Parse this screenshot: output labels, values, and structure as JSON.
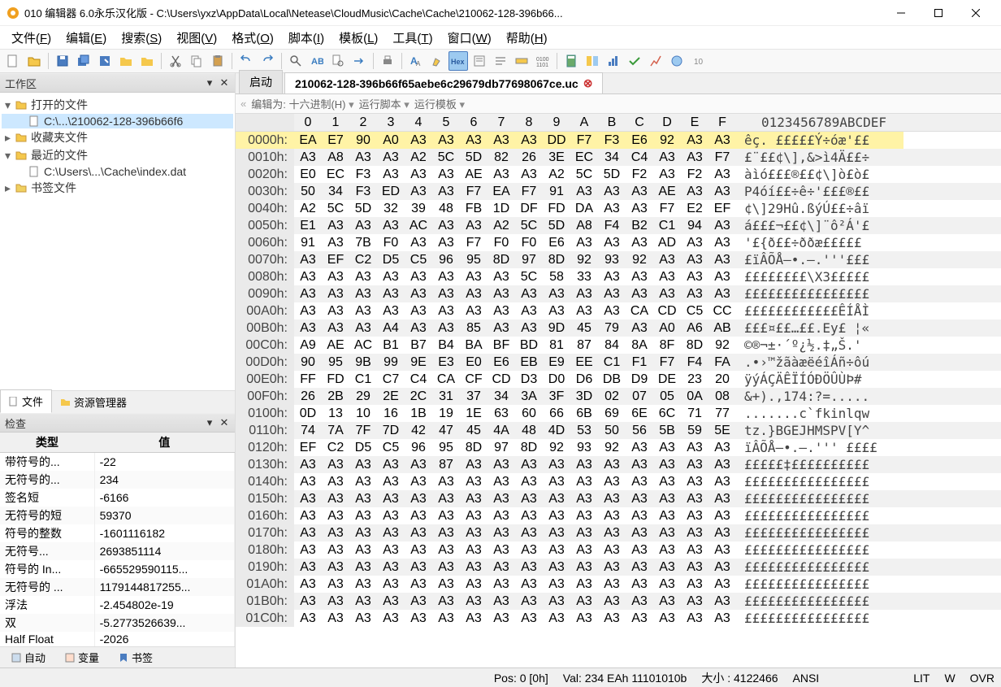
{
  "window": {
    "title": "010 编辑器 6.0永乐汉化版 - C:\\Users\\yxz\\AppData\\Local\\Netease\\CloudMusic\\Cache\\Cache\\210062-128-396b66..."
  },
  "menu": {
    "items": [
      "文件(F)",
      "编辑(E)",
      "搜索(S)",
      "视图(V)",
      "格式(O)",
      "脚本(I)",
      "模板(L)",
      "工具(T)",
      "窗口(W)",
      "帮助(H)"
    ]
  },
  "workspace": {
    "title": "工作区",
    "nodes": [
      {
        "label": "打开的文件",
        "type": "folder",
        "expanded": true,
        "icon": "folder"
      },
      {
        "label": "C:\\...\\210062-128-396b66f6",
        "type": "file",
        "indent": 1,
        "icon": "file",
        "selected": true
      },
      {
        "label": "收藏夹文件",
        "type": "folder",
        "icon": "folder"
      },
      {
        "label": "最近的文件",
        "type": "folder",
        "expanded": true,
        "icon": "folder"
      },
      {
        "label": "C:\\Users\\...\\Cache\\index.dat",
        "type": "file",
        "indent": 1,
        "icon": "file"
      },
      {
        "label": "书签文件",
        "type": "folder",
        "icon": "folder-y"
      }
    ],
    "tabs": [
      {
        "label": "文件",
        "icon": "doc"
      },
      {
        "label": "资源管理器",
        "icon": "folder"
      }
    ]
  },
  "inspector": {
    "title": "检查",
    "headers": {
      "type": "类型",
      "value": "值"
    },
    "rows": [
      {
        "type": "带符号的...",
        "value": "-22"
      },
      {
        "type": "无符号的...",
        "value": "234"
      },
      {
        "type": "签名短",
        "value": "-6166"
      },
      {
        "type": "无符号的短",
        "value": "59370"
      },
      {
        "type": "符号的整数",
        "value": "-1601116182"
      },
      {
        "type": "无符号...",
        "value": "2693851114"
      },
      {
        "type": "符号的 In...",
        "value": "-665529590115..."
      },
      {
        "type": "无符号的 ...",
        "value": "1179144817255..."
      },
      {
        "type": "浮法",
        "value": "-2.454802e-19"
      },
      {
        "type": "双",
        "value": "-5.2773526639..."
      },
      {
        "type": "Half Float",
        "value": "-2026"
      }
    ],
    "bottom_tabs": [
      {
        "label": "自动"
      },
      {
        "label": "变量"
      },
      {
        "label": "书签"
      }
    ]
  },
  "doc_tabs": {
    "items": [
      {
        "label": "启动",
        "active": false,
        "closable": false
      },
      {
        "label": "210062-128-396b66f65aebe6c29679db77698067ce.uc",
        "active": true,
        "closable": true
      }
    ]
  },
  "editor_bar": {
    "edit_as": "编辑为: 十六进制(H)",
    "run_script": "运行脚本",
    "run_template": "运行模板"
  },
  "hex": {
    "cols": [
      "0",
      "1",
      "2",
      "3",
      "4",
      "5",
      "6",
      "7",
      "8",
      "9",
      "A",
      "B",
      "C",
      "D",
      "E",
      "F"
    ],
    "ascii_header": "0123456789ABCDEF",
    "rows": [
      {
        "off": "0000h:",
        "b": [
          "EA",
          "E7",
          "90",
          "A0",
          "A3",
          "A3",
          "A3",
          "A3",
          "A3",
          "DD",
          "F7",
          "F3",
          "E6",
          "92",
          "A3",
          "A3"
        ],
        "a": "êç. £££££Ý÷óæ'££",
        "hl": true
      },
      {
        "off": "0010h:",
        "b": [
          "A3",
          "A8",
          "A3",
          "A3",
          "A2",
          "5C",
          "5D",
          "82",
          "26",
          "3E",
          "EC",
          "34",
          "C4",
          "A3",
          "A3",
          "F7"
        ],
        "a": "£¨££¢\\],&>ì4Ä££÷"
      },
      {
        "off": "0020h:",
        "b": [
          "E0",
          "EC",
          "F3",
          "A3",
          "A3",
          "A3",
          "AE",
          "A3",
          "A3",
          "A2",
          "5C",
          "5D",
          "F2",
          "A3",
          "F2",
          "A3"
        ],
        "a": "àìó£££®££¢\\]ò£ò£"
      },
      {
        "off": "0030h:",
        "b": [
          "50",
          "34",
          "F3",
          "ED",
          "A3",
          "A3",
          "F7",
          "EA",
          "F7",
          "91",
          "A3",
          "A3",
          "A3",
          "AE",
          "A3",
          "A3"
        ],
        "a": "P4óí££÷ê÷'£££®££"
      },
      {
        "off": "0040h:",
        "b": [
          "A2",
          "5C",
          "5D",
          "32",
          "39",
          "48",
          "FB",
          "1D",
          "DF",
          "FD",
          "DA",
          "A3",
          "A3",
          "F7",
          "E2",
          "EF"
        ],
        "a": "¢\\]29Hû.ßýÚ££÷âï"
      },
      {
        "off": "0050h:",
        "b": [
          "E1",
          "A3",
          "A3",
          "A3",
          "AC",
          "A3",
          "A3",
          "A2",
          "5C",
          "5D",
          "A8",
          "F4",
          "B2",
          "C1",
          "94",
          "A3"
        ],
        "a": "á£££¬££¢\\]¨ô²Á'£"
      },
      {
        "off": "0060h:",
        "b": [
          "91",
          "A3",
          "7B",
          "F0",
          "A3",
          "A3",
          "F7",
          "F0",
          "F0",
          "E6",
          "A3",
          "A3",
          "A3",
          "AD",
          "A3",
          "A3"
        ],
        "a": "'£{ð££÷ððæ£££­££"
      },
      {
        "off": "0070h:",
        "b": [
          "A3",
          "EF",
          "C2",
          "D5",
          "C5",
          "96",
          "95",
          "8D",
          "97",
          "8D",
          "92",
          "93",
          "92",
          "A3",
          "A3",
          "A3"
        ],
        "a": "£ïÂÕÅ–•.—.'''£££"
      },
      {
        "off": "0080h:",
        "b": [
          "A3",
          "A3",
          "A3",
          "A3",
          "A3",
          "A3",
          "A3",
          "A3",
          "5C",
          "58",
          "33",
          "A3",
          "A3",
          "A3",
          "A3",
          "A3"
        ],
        "a": "££££££££\\X3£££££"
      },
      {
        "off": "0090h:",
        "b": [
          "A3",
          "A3",
          "A3",
          "A3",
          "A3",
          "A3",
          "A3",
          "A3",
          "A3",
          "A3",
          "A3",
          "A3",
          "A3",
          "A3",
          "A3",
          "A3"
        ],
        "a": "££££££££££££££££"
      },
      {
        "off": "00A0h:",
        "b": [
          "A3",
          "A3",
          "A3",
          "A3",
          "A3",
          "A3",
          "A3",
          "A3",
          "A3",
          "A3",
          "A3",
          "A3",
          "CA",
          "CD",
          "C5",
          "CC"
        ],
        "a": "££££££££££££ÊÍÅÌ"
      },
      {
        "off": "00B0h:",
        "b": [
          "A3",
          "A3",
          "A3",
          "A4",
          "A3",
          "A3",
          "85",
          "A3",
          "A3",
          "9D",
          "45",
          "79",
          "A3",
          "A0",
          "A6",
          "AB"
        ],
        "a": "£££¤££…££.Ey£ ¦«"
      },
      {
        "off": "00C0h:",
        "b": [
          "A9",
          "AE",
          "AC",
          "B1",
          "B7",
          "B4",
          "BA",
          "BF",
          "BD",
          "81",
          "87",
          "84",
          "8A",
          "8F",
          "8D",
          "92"
        ],
        "a": "©®¬±·´º¿½.‡„Š.'"
      },
      {
        "off": "00D0h:",
        "b": [
          "90",
          "95",
          "9B",
          "99",
          "9E",
          "E3",
          "E0",
          "E6",
          "EB",
          "E9",
          "EE",
          "C1",
          "F1",
          "F7",
          "F4",
          "FA"
        ],
        "a": ".•›™žãàæëéîÁñ÷ôú"
      },
      {
        "off": "00E0h:",
        "b": [
          "FF",
          "FD",
          "C1",
          "C7",
          "C4",
          "CA",
          "CF",
          "CD",
          "D3",
          "D0",
          "D6",
          "DB",
          "D9",
          "DE",
          "23",
          "20"
        ],
        "a": "ÿýÁÇÄÊÏÍÓÐÖÛÙÞ# "
      },
      {
        "off": "00F0h:",
        "b": [
          "26",
          "2B",
          "29",
          "2E",
          "2C",
          "31",
          "37",
          "34",
          "3A",
          "3F",
          "3D",
          "02",
          "07",
          "05",
          "0A",
          "08"
        ],
        "a": "&+).,174:?=....."
      },
      {
        "off": "0100h:",
        "b": [
          "0D",
          "13",
          "10",
          "16",
          "1B",
          "19",
          "1E",
          "63",
          "60",
          "66",
          "6B",
          "69",
          "6E",
          "6C",
          "71",
          "77"
        ],
        "a": ".......c`fkinlqw"
      },
      {
        "off": "0110h:",
        "b": [
          "74",
          "7A",
          "7F",
          "7D",
          "42",
          "47",
          "45",
          "4A",
          "48",
          "4D",
          "53",
          "50",
          "56",
          "5B",
          "59",
          "5E"
        ],
        "a": "tz.}BGEJHMSPV[Y^"
      },
      {
        "off": "0120h:",
        "b": [
          "EF",
          "C2",
          "D5",
          "C5",
          "96",
          "95",
          "8D",
          "97",
          "8D",
          "92",
          "93",
          "92",
          "A3",
          "A3",
          "A3",
          "A3"
        ],
        "a": "ïÂÕÅ–•.—.''' ££££"
      },
      {
        "off": "0130h:",
        "b": [
          "A3",
          "A3",
          "A3",
          "A3",
          "A3",
          "87",
          "A3",
          "A3",
          "A3",
          "A3",
          "A3",
          "A3",
          "A3",
          "A3",
          "A3",
          "A3"
        ],
        "a": "£££££‡££££££££££"
      },
      {
        "off": "0140h:",
        "b": [
          "A3",
          "A3",
          "A3",
          "A3",
          "A3",
          "A3",
          "A3",
          "A3",
          "A3",
          "A3",
          "A3",
          "A3",
          "A3",
          "A3",
          "A3",
          "A3"
        ],
        "a": "££££££££££££££££"
      },
      {
        "off": "0150h:",
        "b": [
          "A3",
          "A3",
          "A3",
          "A3",
          "A3",
          "A3",
          "A3",
          "A3",
          "A3",
          "A3",
          "A3",
          "A3",
          "A3",
          "A3",
          "A3",
          "A3"
        ],
        "a": "££££££££££££££££"
      },
      {
        "off": "0160h:",
        "b": [
          "A3",
          "A3",
          "A3",
          "A3",
          "A3",
          "A3",
          "A3",
          "A3",
          "A3",
          "A3",
          "A3",
          "A3",
          "A3",
          "A3",
          "A3",
          "A3"
        ],
        "a": "££££££££££££££££"
      },
      {
        "off": "0170h:",
        "b": [
          "A3",
          "A3",
          "A3",
          "A3",
          "A3",
          "A3",
          "A3",
          "A3",
          "A3",
          "A3",
          "A3",
          "A3",
          "A3",
          "A3",
          "A3",
          "A3"
        ],
        "a": "££££££££££££££££"
      },
      {
        "off": "0180h:",
        "b": [
          "A3",
          "A3",
          "A3",
          "A3",
          "A3",
          "A3",
          "A3",
          "A3",
          "A3",
          "A3",
          "A3",
          "A3",
          "A3",
          "A3",
          "A3",
          "A3"
        ],
        "a": "££££££££££££££££"
      },
      {
        "off": "0190h:",
        "b": [
          "A3",
          "A3",
          "A3",
          "A3",
          "A3",
          "A3",
          "A3",
          "A3",
          "A3",
          "A3",
          "A3",
          "A3",
          "A3",
          "A3",
          "A3",
          "A3"
        ],
        "a": "££££££££££££££££"
      },
      {
        "off": "01A0h:",
        "b": [
          "A3",
          "A3",
          "A3",
          "A3",
          "A3",
          "A3",
          "A3",
          "A3",
          "A3",
          "A3",
          "A3",
          "A3",
          "A3",
          "A3",
          "A3",
          "A3"
        ],
        "a": "££££££££££££££££"
      },
      {
        "off": "01B0h:",
        "b": [
          "A3",
          "A3",
          "A3",
          "A3",
          "A3",
          "A3",
          "A3",
          "A3",
          "A3",
          "A3",
          "A3",
          "A3",
          "A3",
          "A3",
          "A3",
          "A3"
        ],
        "a": "££££££££££££££££"
      },
      {
        "off": "01C0h:",
        "b": [
          "A3",
          "A3",
          "A3",
          "A3",
          "A3",
          "A3",
          "A3",
          "A3",
          "A3",
          "A3",
          "A3",
          "A3",
          "A3",
          "A3",
          "A3",
          "A3"
        ],
        "a": "££££££££££££££££"
      }
    ]
  },
  "status": {
    "pos": "Pos: 0 [0h]",
    "val": "Val: 234 EAh 11101010b",
    "size": "大小 : 4122466",
    "enc": "ANSI",
    "lit": "LIT",
    "w": "W",
    "ovr": "OVR"
  }
}
